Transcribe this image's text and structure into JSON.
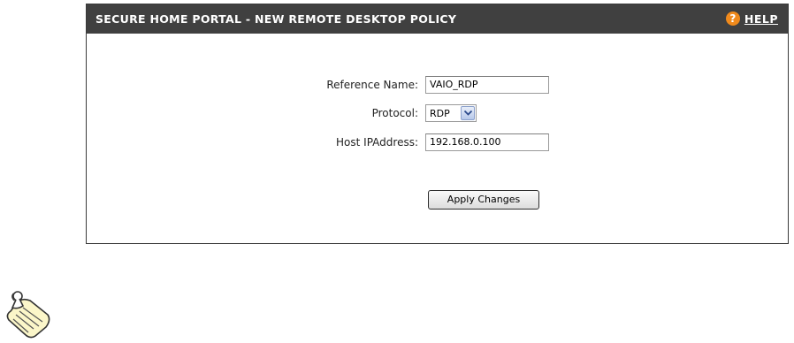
{
  "header": {
    "title": "SECURE HOME PORTAL - NEW REMOTE DESKTOP POLICY",
    "help_icon_glyph": "?",
    "help_label": "HELP"
  },
  "form": {
    "reference_name": {
      "label": "Reference Name:",
      "value": "VAIO_RDP"
    },
    "protocol": {
      "label": "Protocol:",
      "selected": "RDP"
    },
    "host_ip": {
      "label": "Host IPAddress:",
      "value": "192.168.0.100"
    },
    "apply_label": "Apply Changes"
  },
  "icons": {
    "help": "help-icon",
    "note": "note-icon",
    "dropdown": "chevron-down-icon"
  },
  "colors": {
    "header_bg": "#404040",
    "help_icon_bg": "#f08a1c"
  }
}
